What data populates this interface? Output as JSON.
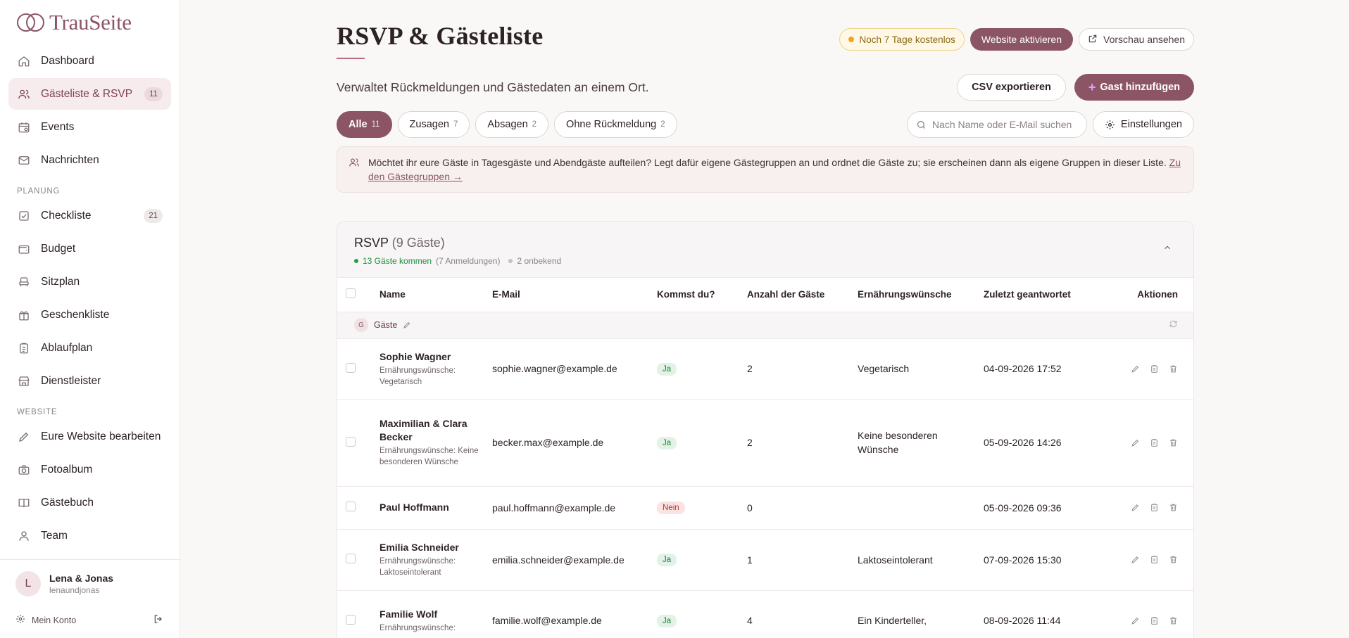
{
  "app": {
    "logo_text": "TrauSeite"
  },
  "sidebar": {
    "items": [
      {
        "label": "Dashboard",
        "icon": "home-icon"
      },
      {
        "label": "Gästeliste & RSVP",
        "icon": "users-icon",
        "badge": "11",
        "active": true
      },
      {
        "label": "Events",
        "icon": "calendar-icon"
      },
      {
        "label": "Nachrichten",
        "icon": "mail-icon"
      }
    ],
    "section_planung": "PLANUNG",
    "planung_items": [
      {
        "label": "Checkliste",
        "icon": "checklist-icon",
        "badge": "21"
      },
      {
        "label": "Budget",
        "icon": "wallet-icon"
      },
      {
        "label": "Sitzplan",
        "icon": "seat-icon"
      },
      {
        "label": "Geschenkliste",
        "icon": "gift-icon"
      },
      {
        "label": "Ablaufplan",
        "icon": "clipboard-icon"
      },
      {
        "label": "Dienstleister",
        "icon": "store-icon"
      }
    ],
    "section_website": "WEBSITE",
    "website_items": [
      {
        "label": "Eure Website bearbeiten",
        "icon": "pencil-icon"
      },
      {
        "label": "Fotoalbum",
        "icon": "camera-icon"
      },
      {
        "label": "Gästebuch",
        "icon": "book-icon"
      },
      {
        "label": "Team",
        "icon": "user-icon"
      }
    ],
    "user": {
      "initial": "L",
      "name": "Lena & Jonas",
      "handle": "lenaundjonas"
    },
    "account_label": "Mein Konto"
  },
  "header": {
    "title": "RSVP & Gästeliste",
    "trial_text": "Noch 7 Tage kostenlos",
    "activate_label": "Website aktivieren",
    "preview_label": "Vorschau ansehen",
    "subtitle": "Verwaltet Rückmeldungen und Gästedaten an einem Ort.",
    "csv_label": "CSV exportieren",
    "add_label": "Gast hinzufügen"
  },
  "filters": {
    "tabs": [
      {
        "label": "Alle",
        "count": "11",
        "active": true
      },
      {
        "label": "Zusagen",
        "count": "7"
      },
      {
        "label": "Absagen",
        "count": "2"
      },
      {
        "label": "Ohne Rückmeldung",
        "count": "2"
      }
    ],
    "search_placeholder": "Nach Name oder E-Mail suchen",
    "settings_label": "Einstellungen"
  },
  "info": {
    "text": "Möchtet ihr eure Gäste in Tagesgäste und Abendgäste aufteilen? Legt dafür eigene Gästegruppen an und ordnet die Gäste zu; sie erscheinen dann als eigene Gruppen in dieser Liste.",
    "link": "Zu den Gästegruppen →"
  },
  "rsvp": {
    "title": "RSVP",
    "count": "(9 Gäste)",
    "coming": "13 Gäste kommen",
    "registrations": "(7 Anmeldungen)",
    "unknown": "2 onbekend",
    "columns": [
      "Name",
      "E-Mail",
      "Kommst du?",
      "Anzahl der Gäste",
      "Ernährungswünsche",
      "Zuletzt geantwortet",
      "Aktionen"
    ],
    "group": {
      "letter": "G",
      "name": "Gäste"
    },
    "rows": [
      {
        "name": "Sophie Wagner",
        "sub": "Ernährungswünsche: Vegetarisch",
        "email": "sophie.wagner@example.de",
        "rsvp": "Ja",
        "count": "2",
        "diet": "Vegetarisch",
        "last": "04-09-2026 17:52"
      },
      {
        "name": "Maximilian & Clara Becker",
        "sub": "Ernährungswünsche: Keine besonderen Wünsche",
        "email": "becker.max@example.de",
        "rsvp": "Ja",
        "count": "2",
        "diet": "Keine besonderen Wünsche",
        "last": "05-09-2026 14:26"
      },
      {
        "name": "Paul Hoffmann",
        "sub": "",
        "email": "paul.hoffmann@example.de",
        "rsvp": "Nein",
        "count": "0",
        "diet": "",
        "last": "05-09-2026 09:36"
      },
      {
        "name": "Emilia Schneider",
        "sub": "Ernährungswünsche: Laktoseintolerant",
        "email": "emilia.schneider@example.de",
        "rsvp": "Ja",
        "count": "1",
        "diet": "Laktoseintolerant",
        "last": "07-09-2026 15:30"
      },
      {
        "name": "Familie Wolf",
        "sub": "Ernährungswünsche:",
        "email": "familie.wolf@example.de",
        "rsvp": "Ja",
        "count": "4",
        "diet": "Ein Kinderteller,",
        "last": "08-09-2026 11:44"
      }
    ]
  },
  "colors": {
    "brand": "#8c5566",
    "accent_light": "#f6ecee",
    "success": "#1fa34a"
  }
}
